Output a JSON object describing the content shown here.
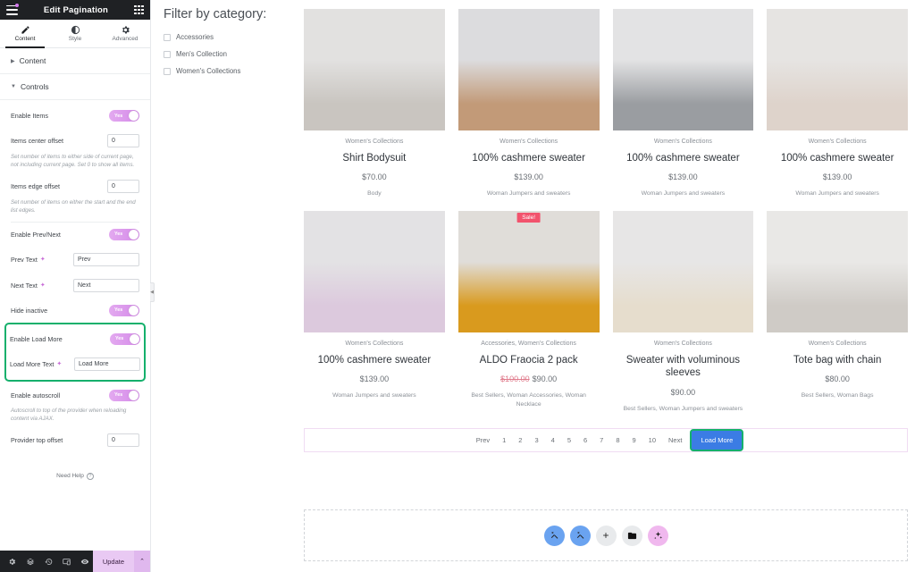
{
  "panel": {
    "title": "Edit Pagination",
    "menu_icon": "hamburger-icon",
    "apps_icon": "grid-icon",
    "tabs": [
      {
        "label": "Content",
        "icon": "pencil-icon",
        "active": true
      },
      {
        "label": "Style",
        "icon": "contrast-icon",
        "active": false
      },
      {
        "label": "Advanced",
        "icon": "gear-icon",
        "active": false
      }
    ],
    "sections": [
      {
        "label": "Content",
        "expanded": false
      },
      {
        "label": "Controls",
        "expanded": true
      }
    ],
    "controls": {
      "enable_items_label": "Enable Items",
      "enable_items_value": "Yes",
      "items_center_offset_label": "Items center offset",
      "items_center_offset_value": "0",
      "items_center_offset_hint": "Set number of items to either side of current page, not including current page. Set 0 to show all items.",
      "items_edge_offset_label": "Items edge offset",
      "items_edge_offset_value": "0",
      "items_edge_offset_hint": "Set number of items on either the start and the end list edges.",
      "enable_prev_next_label": "Enable Prev/Next",
      "enable_prev_next_value": "Yes",
      "prev_text_label": "Prev Text",
      "prev_text_value": "Prev",
      "next_text_label": "Next Text",
      "next_text_value": "Next",
      "hide_inactive_label": "Hide inactive",
      "hide_inactive_value": "Yes",
      "enable_load_more_label": "Enable Load More",
      "enable_load_more_value": "Yes",
      "load_more_text_label": "Load More Text",
      "load_more_text_value": "Load More",
      "enable_autoscroll_label": "Enable autoscroll",
      "enable_autoscroll_value": "Yes",
      "autoscroll_hint": "Autoscroll to top of the provider when reloading content via AJAX.",
      "provider_top_offset_label": "Provider top offset",
      "provider_top_offset_value": "0"
    },
    "need_help": "Need Help",
    "footer": {
      "update_label": "Update",
      "icons": [
        "gear-icon",
        "layers-icon",
        "history-icon",
        "responsive-icon",
        "preview-icon"
      ],
      "caret": "⌃"
    },
    "highlight_color": "#15b06c"
  },
  "canvas": {
    "filter": {
      "title": "Filter by category:",
      "options": [
        {
          "label": "Accessories",
          "checked": false
        },
        {
          "label": "Men's Collection",
          "checked": false
        },
        {
          "label": "Women's Collections",
          "checked": false
        }
      ]
    },
    "products": [
      {
        "category": "Women's Collections",
        "name": "Shirt Bodysuit",
        "price": "$70.00",
        "old_price": "",
        "tags": "Body",
        "badge": "",
        "img_top": "#e2e1e0",
        "img_bottom": "#c9c5c0"
      },
      {
        "category": "Women's Collections",
        "name": "100% cashmere sweater",
        "price": "$139.00",
        "old_price": "",
        "tags": "Woman Jumpers and sweaters",
        "badge": "",
        "img_top": "#dcdcde",
        "img_bottom": "#c29a78"
      },
      {
        "category": "Women's Collections",
        "name": "100% cashmere sweater",
        "price": "$139.00",
        "old_price": "",
        "tags": "Woman Jumpers and sweaters",
        "badge": "",
        "img_top": "#e3e3e4",
        "img_bottom": "#9a9da1"
      },
      {
        "category": "Women's Collections",
        "name": "100% cashmere sweater",
        "price": "$139.00",
        "old_price": "",
        "tags": "Woman Jumpers and sweaters",
        "badge": "",
        "img_top": "#e6e4e2",
        "img_bottom": "#ded3cb"
      },
      {
        "category": "Women's Collections",
        "name": "100% cashmere sweater",
        "price": "$139.00",
        "old_price": "",
        "tags": "Woman Jumpers and sweaters",
        "badge": "",
        "img_top": "#e3e2e4",
        "img_bottom": "#dcc9dd"
      },
      {
        "category": "Accessories, Women's Collections",
        "name": "ALDO Fraocia 2 pack",
        "price": "$90.00",
        "old_price": "$100.00",
        "tags": "Best Sellers, Woman Accessories, Woman Necklace",
        "badge": "Sale!",
        "img_top": "#e0ddd9",
        "img_bottom": "#d99a1e"
      },
      {
        "category": "Women's Collections",
        "name": "Sweater with voluminous sleeves",
        "price": "$90.00",
        "old_price": "",
        "tags": "Best Sellers, Woman Jumpers and sweaters",
        "badge": "",
        "img_top": "#e7e6e6",
        "img_bottom": "#e6ddcd"
      },
      {
        "category": "Women's Collections",
        "name": "Tote bag with chain",
        "price": "$80.00",
        "old_price": "",
        "tags": "Best Sellers, Woman Bags",
        "badge": "",
        "img_top": "#e9e8e6",
        "img_bottom": "#cfcbc6"
      }
    ],
    "pagination": {
      "prev_label": "Prev",
      "pages": [
        "1",
        "2",
        "3",
        "4",
        "5",
        "6",
        "7",
        "8",
        "9",
        "10"
      ],
      "next_label": "Next",
      "load_more_label": "Load More",
      "load_more_color": "#3b7ce4"
    },
    "fabs": [
      {
        "name": "magic-wand-icon",
        "style": "blue"
      },
      {
        "name": "magic-wand-icon",
        "style": "blue"
      },
      {
        "name": "plus-icon",
        "style": "grey"
      },
      {
        "name": "folder-icon",
        "style": "grey"
      },
      {
        "name": "sparkle-icon",
        "style": "pink"
      }
    ]
  }
}
